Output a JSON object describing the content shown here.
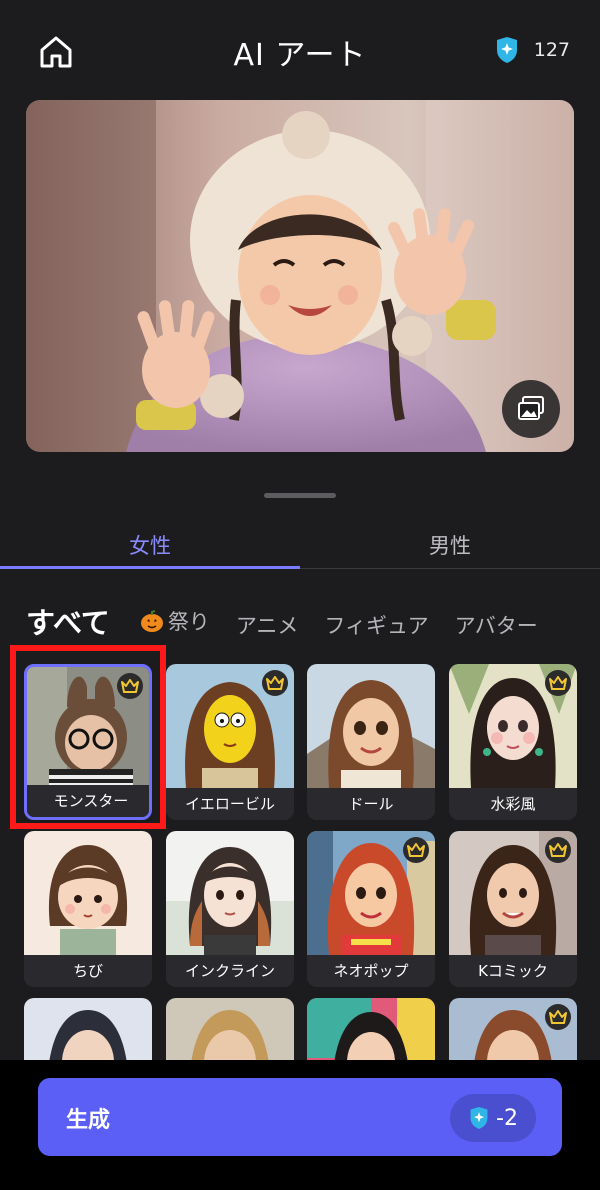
{
  "header": {
    "title": "AI アート",
    "home_icon": "home-icon",
    "credits_icon": "shield-credit-icon",
    "credits": "127"
  },
  "preview": {
    "gallery_icon": "gallery-icon"
  },
  "tabs": [
    {
      "label": "女性",
      "active": true
    },
    {
      "label": "男性",
      "active": false
    }
  ],
  "categories": [
    {
      "label": "すべて",
      "active": true
    },
    {
      "label": "祭り",
      "icon": "pumpkin-icon"
    },
    {
      "label": "アニメ"
    },
    {
      "label": "フィギュア"
    },
    {
      "label": "アバター"
    }
  ],
  "styles": [
    {
      "label": "モンスター",
      "premium": true,
      "selected": true
    },
    {
      "label": "イエロービル",
      "premium": true
    },
    {
      "label": "ドール",
      "premium": false
    },
    {
      "label": "水彩風",
      "premium": true
    },
    {
      "label": "ちび",
      "premium": false
    },
    {
      "label": "インクライン",
      "premium": false
    },
    {
      "label": "ネオポップ",
      "premium": true
    },
    {
      "label": "Kコミック",
      "premium": true
    },
    {
      "label": "",
      "premium": false
    },
    {
      "label": "",
      "premium": false
    },
    {
      "label": "",
      "premium": false
    },
    {
      "label": "",
      "premium": true
    }
  ],
  "generate": {
    "label": "生成",
    "cost": "-2"
  },
  "colors": {
    "accent": "#5b5ff5",
    "tab_active": "#8b8bff",
    "highlight": "#ff1a1a"
  }
}
